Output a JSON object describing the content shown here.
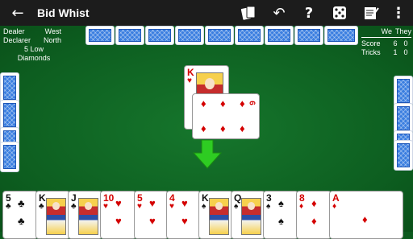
{
  "app": {
    "title": "Bid Whist"
  },
  "toolbar": {
    "back_icon": "←",
    "undo_icon": "↶",
    "help_icon": "?",
    "menu_icon": "⋮"
  },
  "game_info": {
    "dealer_label": "Dealer",
    "dealer_value": "West",
    "declarer_label": "Declarer",
    "declarer_value": "North",
    "bid_line1": "5 Low",
    "bid_line2": "Diamonds"
  },
  "score": {
    "we_label": "We",
    "they_label": "They",
    "score_label": "Score",
    "score_we": "6",
    "score_they": "0",
    "tricks_label": "Tricks",
    "tricks_we": "1",
    "tricks_they": "0"
  },
  "trick": {
    "card1": {
      "rank": "K",
      "suit": "♥"
    },
    "card2": {
      "rank": "6",
      "suit": "♦"
    }
  },
  "hand": [
    {
      "rank": "5",
      "suit": "♣"
    },
    {
      "rank": "K",
      "suit": "♣"
    },
    {
      "rank": "J",
      "suit": "♣"
    },
    {
      "rank": "10",
      "suit": "♥"
    },
    {
      "rank": "5",
      "suit": "♥"
    },
    {
      "rank": "4",
      "suit": "♥"
    },
    {
      "rank": "K",
      "suit": "♠"
    },
    {
      "rank": "Q",
      "suit": "♠"
    },
    {
      "rank": "3",
      "suit": "♠"
    },
    {
      "rank": "8",
      "suit": "♦"
    },
    {
      "rank": "A",
      "suit": "♦"
    }
  ],
  "colors": {
    "felt": "#0c5a1e",
    "appbar": "#1c1c1c",
    "card_back": "#3a7ee0",
    "arrow": "#2ecc22",
    "red_suit": "#d40000"
  }
}
